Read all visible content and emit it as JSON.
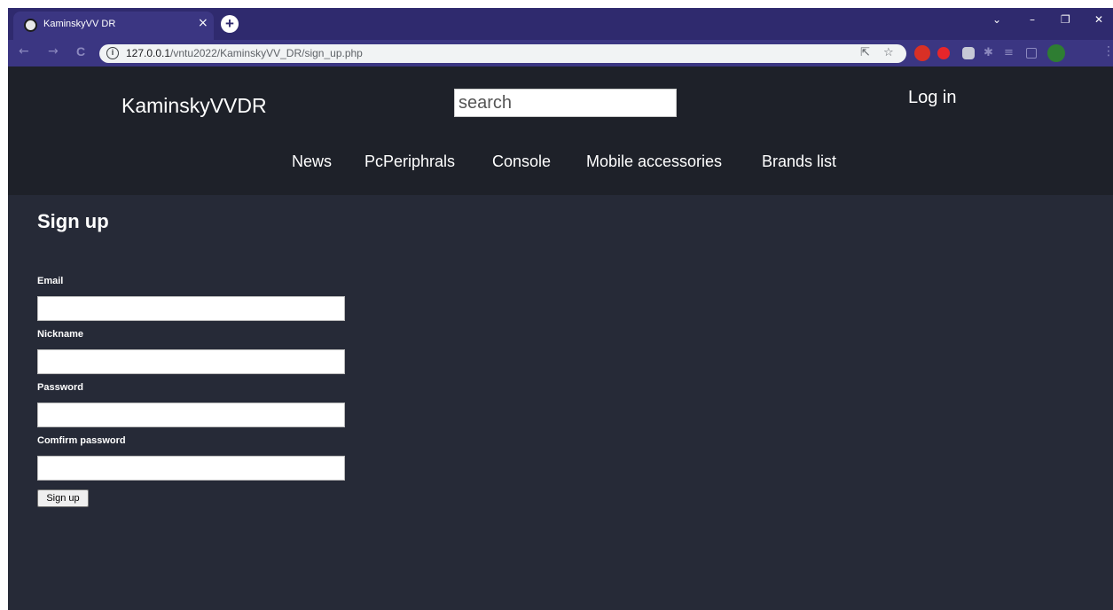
{
  "browser": {
    "tab_title": "KaminskyVV DR",
    "tab_close": "×",
    "new_tab": "+",
    "url_host": "127.0.0.1",
    "url_path": "/vntu2022/KaminskyVV_DR/sign_up.php",
    "window_controls": [
      "⌄",
      "–",
      "❐",
      "✕"
    ],
    "nav_icons": [
      "←",
      "→",
      "C"
    ],
    "omnibox_icons": [
      "share-icon",
      "star-icon"
    ],
    "extension_icons": [
      "calendar-extension-icon",
      "adblock-icon",
      "extension-square-icon",
      "puzzle-icon",
      "reading-list-icon",
      "side-panel-icon",
      "profile-avatar-icon"
    ]
  },
  "site": {
    "brand": "KaminskyVVDR",
    "search_placeholder": "search",
    "login_label": "Log in",
    "nav": [
      "News",
      "PcPeriphrals",
      "Console",
      "Mobile accessories",
      "Brands list"
    ]
  },
  "form": {
    "title": "Sign up",
    "fields": [
      {
        "label": "Email",
        "value": ""
      },
      {
        "label": "Nickname",
        "value": ""
      },
      {
        "label": "Password",
        "value": ""
      },
      {
        "label": "Comfirm password",
        "value": ""
      }
    ],
    "submit_label": "Sign up"
  },
  "colors": {
    "tabstrip": "#2f2a6e",
    "toolbar": "#3b3682",
    "header_bg": "#1e2129",
    "content_bg": "#262a37"
  }
}
